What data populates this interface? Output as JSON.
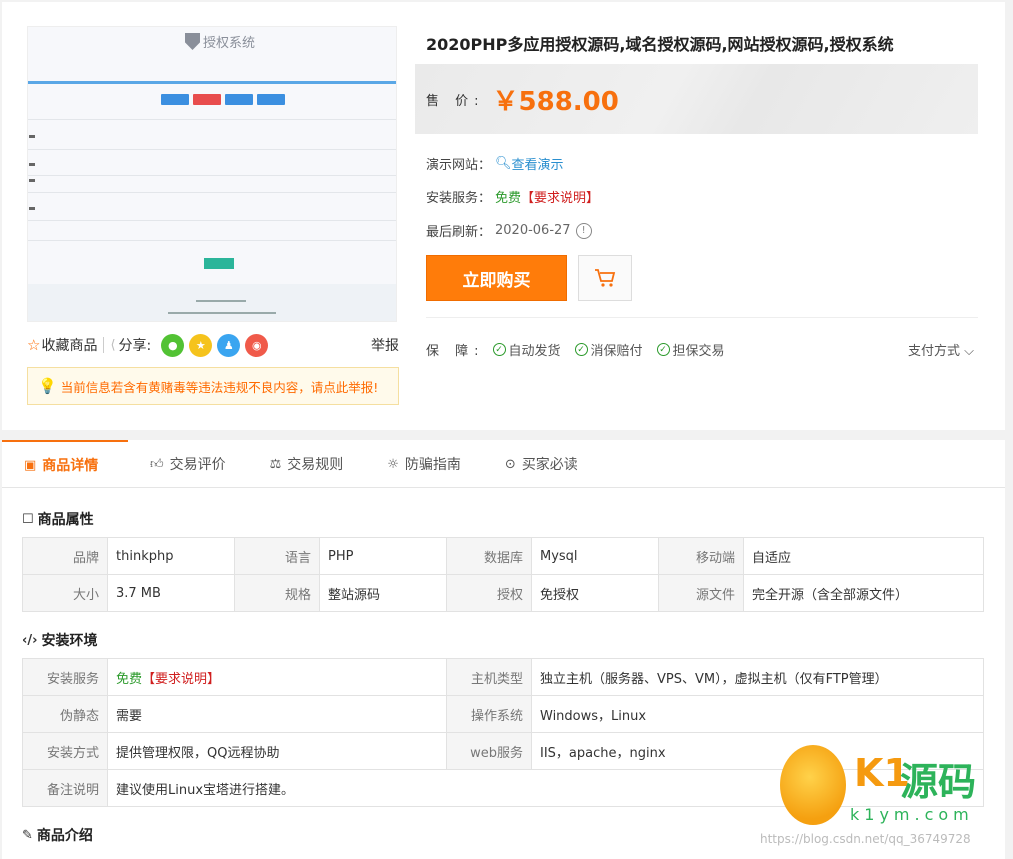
{
  "preview": {
    "logo_text": "授权系统",
    "button_colors": [
      "#3b8fe0",
      "#e84d4d",
      "#3b8fe0",
      "#3b8fe0"
    ],
    "go_color": "#2bb59a"
  },
  "share_bar": {
    "favorite_label": "收藏商品",
    "share_label": "分享:",
    "report_label": "举报"
  },
  "notice": {
    "text": "当前信息若含有黄赌毒等违法违规不良内容，请点此举报!"
  },
  "product": {
    "title": "2020PHP多应用授权源码,域名授权源码,网站授权源码,授权系统",
    "price_label": "售 价:",
    "price": "￥588.00",
    "demo_key": "演示网站：",
    "demo_value": "查看演示",
    "install_key": "安装服务：",
    "install_free": "免费",
    "install_note": "【要求说明】",
    "refresh_key": "最后刷新：",
    "refresh_value": "2020-06-27",
    "buy_label": "立即购买",
    "guard_key": "保 障:",
    "guards": [
      "自动发货",
      "消保赔付",
      "担保交易"
    ],
    "pay_label": "支付方式"
  },
  "tabs": [
    {
      "label": "商品详情",
      "icon": "image-icon"
    },
    {
      "label": "交易评价",
      "icon": "thumb-up-icon"
    },
    {
      "label": "交易规则",
      "icon": "scale-icon"
    },
    {
      "label": "防骗指南",
      "icon": "bulb-icon"
    },
    {
      "label": "买家必读",
      "icon": "target-icon"
    }
  ],
  "attributes": {
    "title": "商品属性",
    "rows": [
      [
        "品牌",
        "thinkphp",
        "语言",
        "PHP",
        "数据库",
        "Mysql",
        "移动端",
        "自适应"
      ],
      [
        "大小",
        "3.7 MB",
        "规格",
        "整站源码",
        "授权",
        "免授权",
        "源文件",
        "完全开源（含全部源文件）"
      ]
    ]
  },
  "environment": {
    "title": "安装环境",
    "service_key": "安装服务",
    "service_free": "免费",
    "service_note": "【要求说明】",
    "host_key": "主机类型",
    "host_value": "独立主机（服务器、VPS、VM），虚拟主机（仅有FTP管理）",
    "rewrite_key": "伪静态",
    "rewrite_value": "需要",
    "os_key": "操作系统",
    "os_value": "Windows，Linux",
    "method_key": "安装方式",
    "method_value": "提供管理权限，QQ远程协助",
    "web_key": "web服务",
    "web_value": "IIS，apache，nginx",
    "remark_key": "备注说明",
    "remark_value": "建议使用Linux宝塔进行搭建。"
  },
  "intro": {
    "title": "商品介绍"
  },
  "watermark": {
    "brand_k": "K1",
    "brand_cn": "源码",
    "url": "k1ym.com",
    "csdn": "https://blog.csdn.net/qq_36749728"
  }
}
